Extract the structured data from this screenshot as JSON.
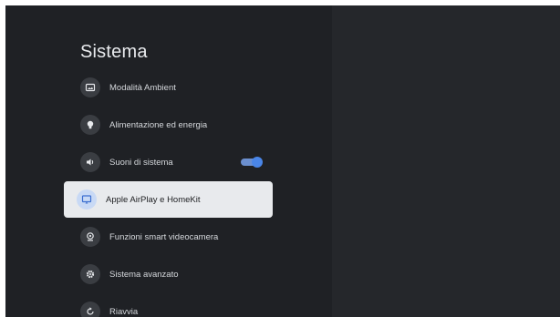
{
  "page": {
    "title": "Sistema"
  },
  "menu": {
    "items": [
      {
        "label": "Modalità Ambient",
        "icon": "ambient-mode-icon"
      },
      {
        "label": "Alimentazione ed energia",
        "icon": "lightbulb-icon"
      },
      {
        "label": "Suoni di sistema",
        "icon": "speaker-icon",
        "toggle": true
      },
      {
        "label": "Apple AirPlay e HomeKit",
        "icon": "cast-icon",
        "selected": true
      },
      {
        "label": "Funzioni smart videocamera",
        "icon": "webcam-icon"
      },
      {
        "label": "Sistema avanzato",
        "icon": "gear-icon"
      },
      {
        "label": "Riavvia",
        "icon": "restart-icon"
      }
    ]
  },
  "colors": {
    "background": "#1f2125",
    "right_pane": "#25272b",
    "selected_item": "#e8eaed",
    "toggle_accent": "#4a86e8"
  }
}
